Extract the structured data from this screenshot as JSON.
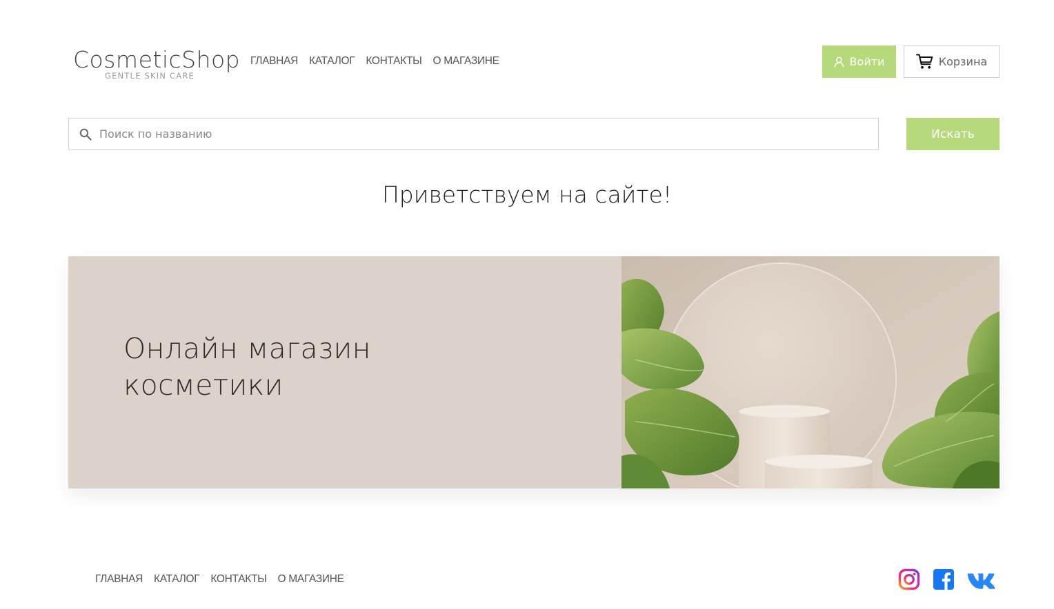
{
  "header": {
    "logo": {
      "title": "CosmeticShop",
      "subtitle": "GENTLE SKIN CARE"
    },
    "nav": [
      {
        "label": "ГЛАВНАЯ"
      },
      {
        "label": "КАТАЛОГ"
      },
      {
        "label": "КОНТАКТЫ"
      },
      {
        "label": "О МАГАЗИНЕ"
      }
    ],
    "login_label": "Войти",
    "cart_label": "Корзина"
  },
  "search": {
    "placeholder": "Поиск по названию",
    "value": "",
    "button_label": "Искать"
  },
  "main": {
    "welcome": "Приветствуем на сайте!",
    "banner": {
      "line1": "Онлайн магазин",
      "line2": "косметики"
    }
  },
  "footer": {
    "nav": [
      {
        "label": "ГЛАВНАЯ"
      },
      {
        "label": "КАТАЛОГ"
      },
      {
        "label": "КОНТАКТЫ"
      },
      {
        "label": "О МАГАЗИНЕ"
      }
    ],
    "socials": [
      {
        "icon": "instagram-icon"
      },
      {
        "icon": "facebook-icon"
      },
      {
        "icon": "vk-icon"
      }
    ]
  },
  "colors": {
    "accent": "#b6d97b",
    "banner_bg": "#dcd2ca",
    "border": "#cfcfcf",
    "facebook": "#1877f2",
    "vk": "#2787f5"
  }
}
